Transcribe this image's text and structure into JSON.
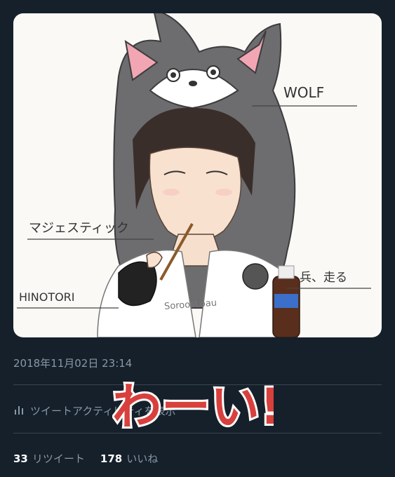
{
  "tweet": {
    "media_alt": "illustration",
    "timestamp": "2018年11月02日 23:14",
    "activity_label": "ツイートアクティビティを表示",
    "retweets": {
      "count": "33",
      "label": "リツイート"
    },
    "likes": {
      "count": "178",
      "label": "いいね"
    }
  },
  "illustration": {
    "label_wolf": "WOLF",
    "label_majestic": "マジェスティック",
    "label_hinotori": "HINOTORI",
    "label_heisoru": "兵、走る",
    "signature": "SoroosLoau"
  },
  "overlay": {
    "text": "わーい!"
  },
  "colors": {
    "background": "#15202b",
    "muted_text": "#8899a6",
    "divider": "#38444d",
    "overlay_fill": "#d8403d"
  }
}
